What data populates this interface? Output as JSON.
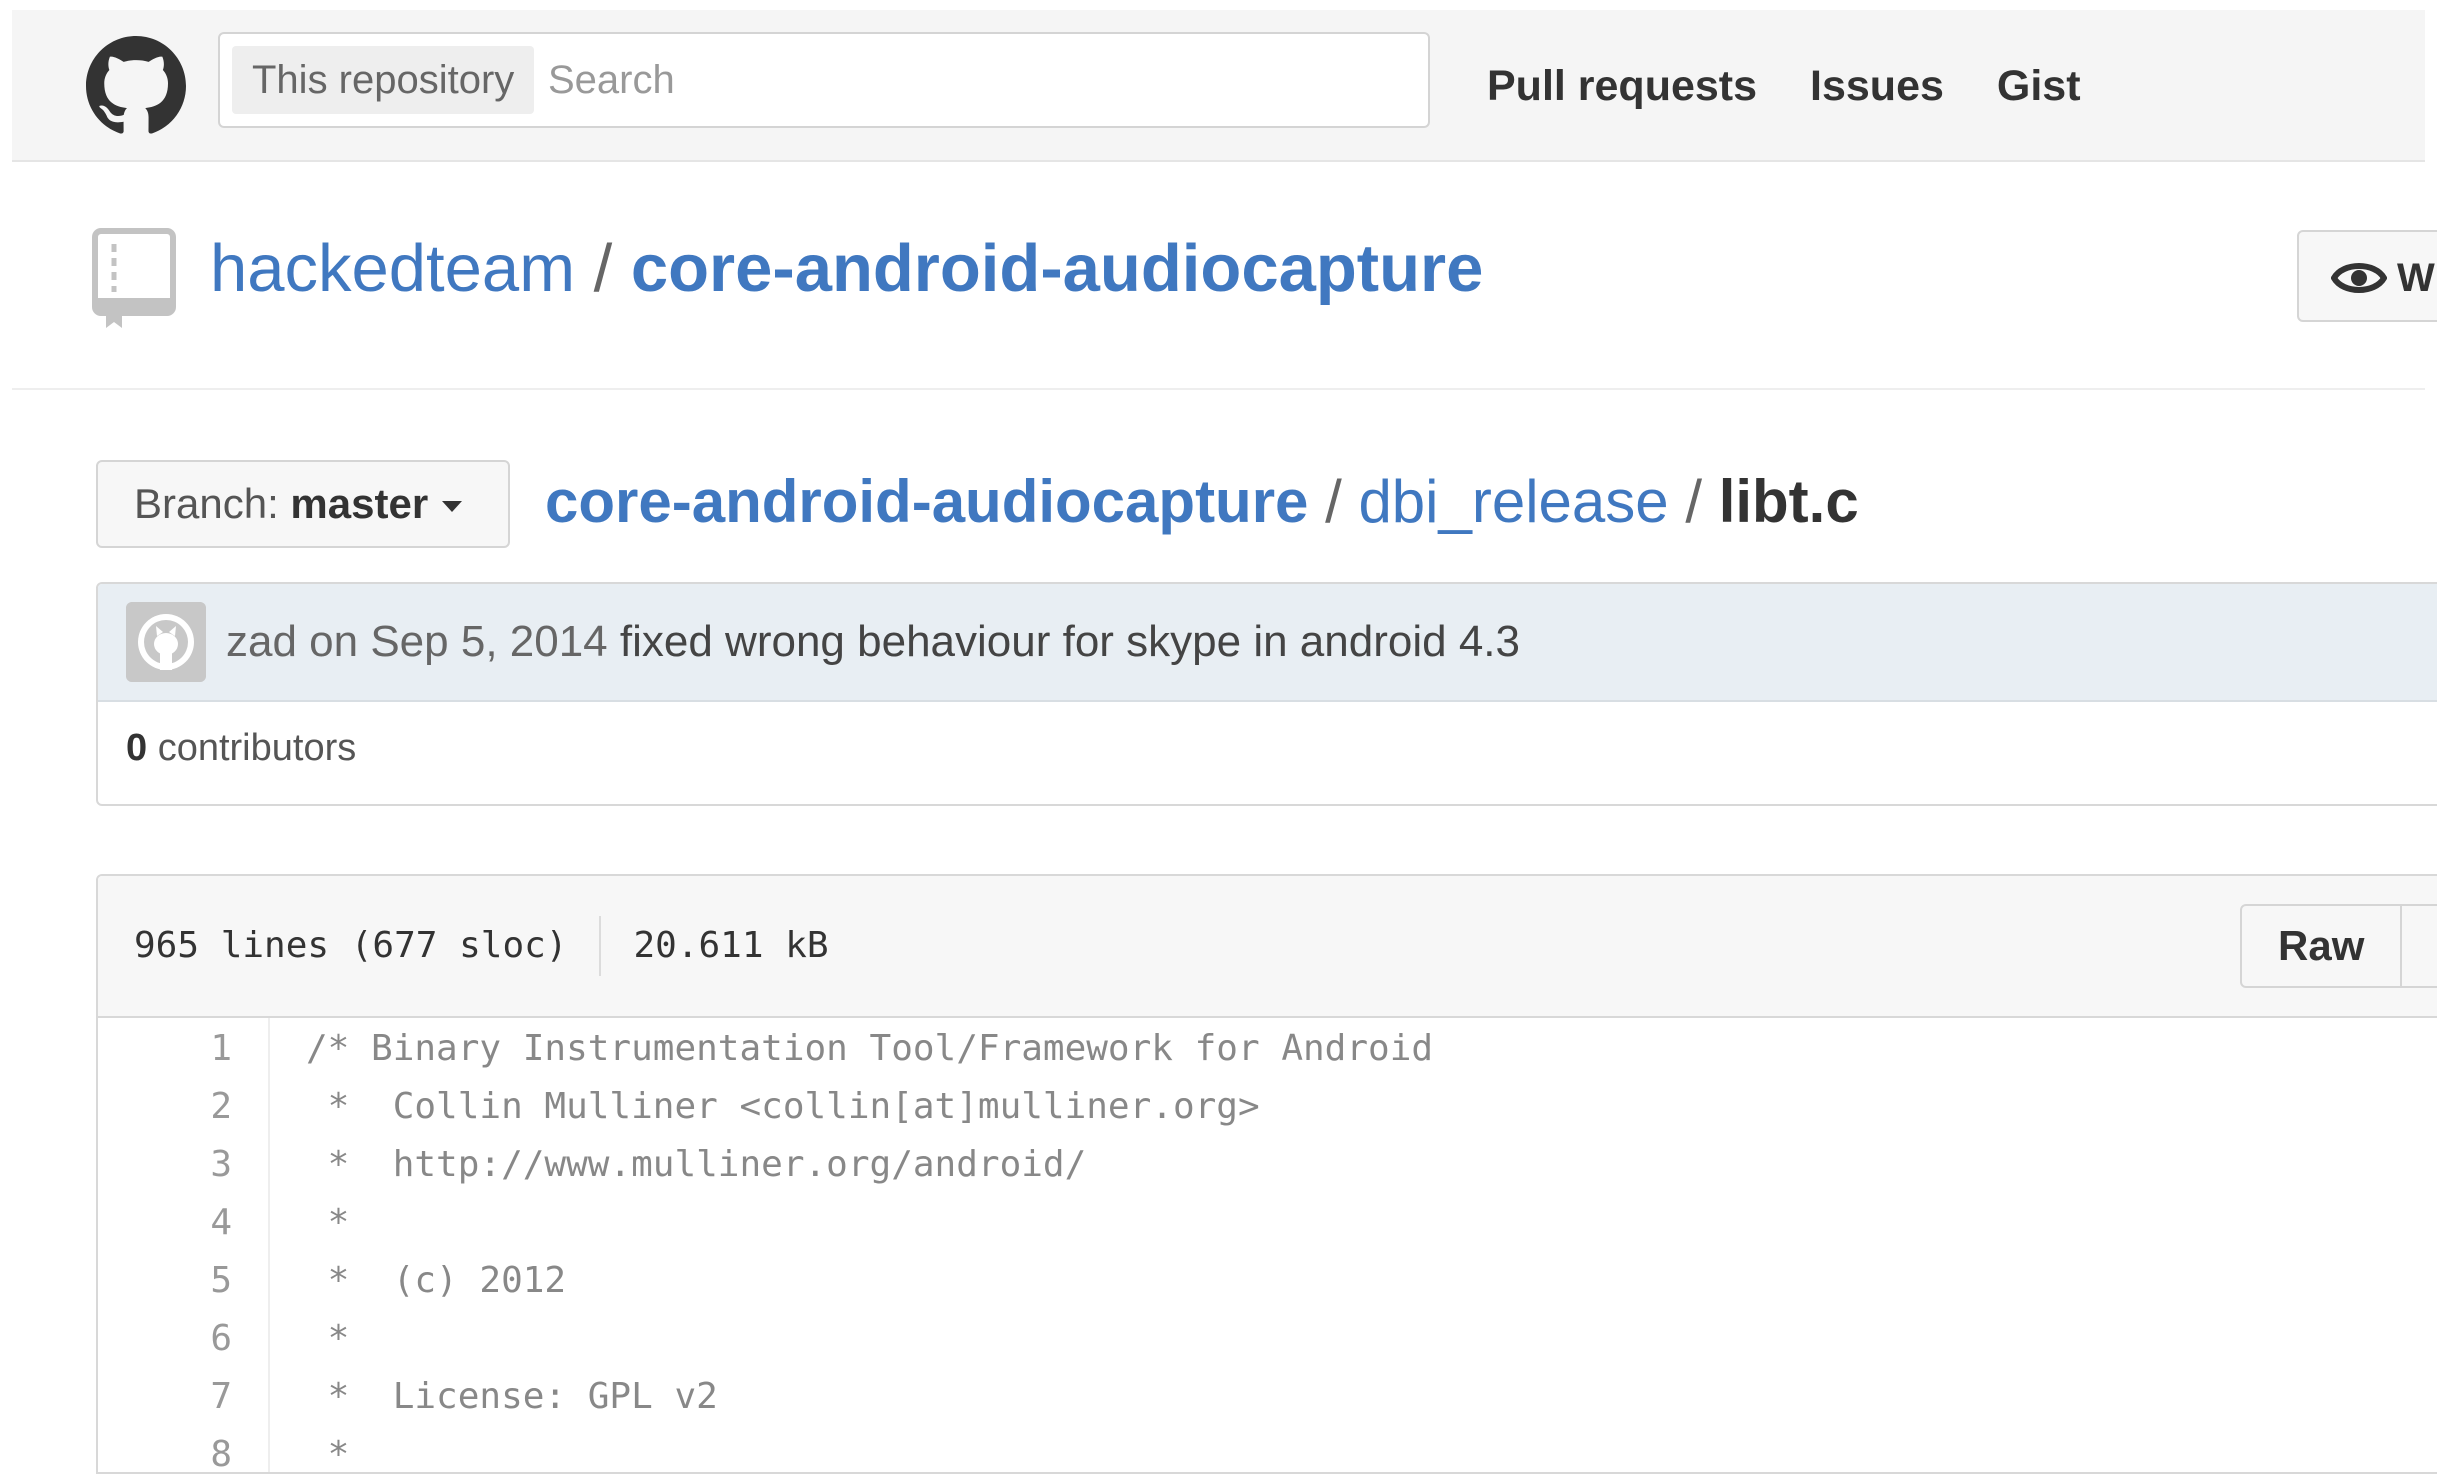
{
  "header": {
    "search_scope": "This repository",
    "search_placeholder": "Search",
    "nav": [
      "Pull requests",
      "Issues",
      "Gist"
    ]
  },
  "repo": {
    "owner": "hackedteam",
    "separator": " / ",
    "name": "core-android-audiocapture",
    "watch_label": "W"
  },
  "branch": {
    "prefix": "Branch: ",
    "name": "master"
  },
  "breadcrumb": {
    "root": "core-android-audiocapture",
    "dir": "dbi_release",
    "file": "libt.c",
    "separator": " / "
  },
  "commit": {
    "meta": "zad on Sep 5, 2014",
    "message": "fixed wrong behaviour for skype in android 4.3"
  },
  "contributors": {
    "count": "0",
    "label": " contributors"
  },
  "file": {
    "lines_info": "965 lines (677 sloc)",
    "size": "20.611 kB",
    "raw_label": "Raw"
  },
  "code": [
    {
      "num": "1",
      "text": "/* Binary Instrumentation Tool/Framework for Android"
    },
    {
      "num": "2",
      "text": " *  Collin Mulliner <collin[at]mulliner.org>"
    },
    {
      "num": "3",
      "text": " *  http://www.mulliner.org/android/"
    },
    {
      "num": "4",
      "text": " *"
    },
    {
      "num": "5",
      "text": " *  (c) 2012"
    },
    {
      "num": "6",
      "text": " *"
    },
    {
      "num": "7",
      "text": " *  License: GPL v2"
    },
    {
      "num": "8",
      "text": " *"
    }
  ]
}
